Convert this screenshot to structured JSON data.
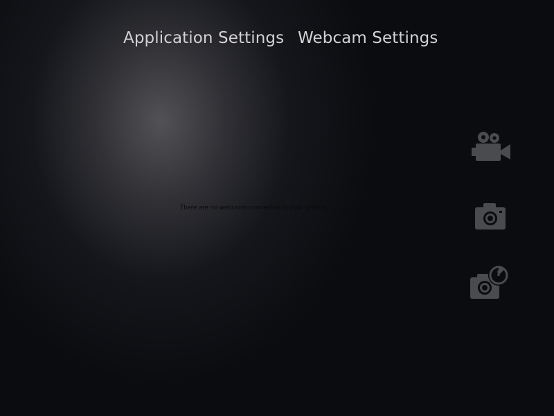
{
  "nav": {
    "application_settings": "Application Settings",
    "webcam_settings": "Webcam Settings"
  },
  "main": {
    "status_message": "There are no webcams connected to your system."
  },
  "side_controls": [
    {
      "icon": "video-camera-icon",
      "action": "record video"
    },
    {
      "icon": "camera-icon",
      "action": "take photo"
    },
    {
      "icon": "camera-timer-icon",
      "action": "timed photo"
    }
  ],
  "colors": {
    "background": "#0b0c10",
    "glow": "#525256",
    "nav_text": "#d2d2d4",
    "icon": "#4a4b4f"
  }
}
